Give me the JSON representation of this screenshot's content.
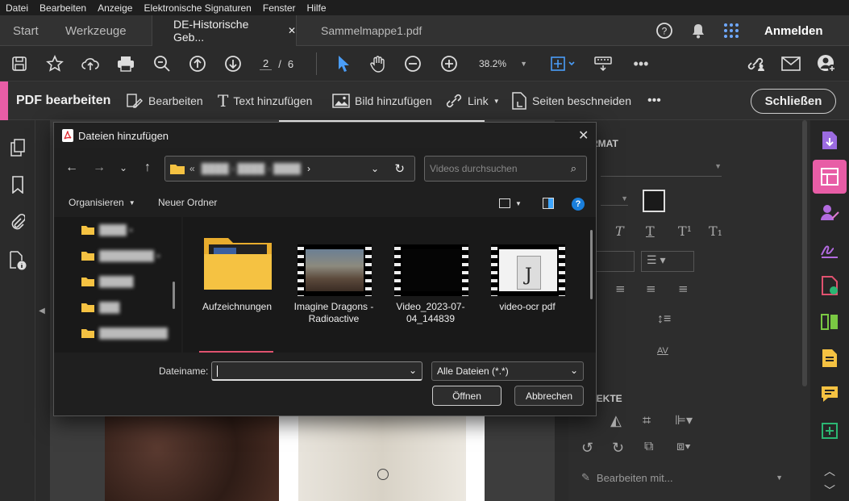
{
  "menu": [
    "Datei",
    "Bearbeiten",
    "Anzeige",
    "Elektronische Signaturen",
    "Fenster",
    "Hilfe"
  ],
  "tabs": {
    "start": "Start",
    "tools": "Werkzeuge",
    "doc1": "DE-Historische Geb...",
    "doc2": "Sammelmappe1.pdf",
    "close": "✕"
  },
  "header": {
    "signin": "Anmelden"
  },
  "toolbar": {
    "page_current": "2",
    "page_sep": "/",
    "page_total": "6",
    "zoom": "38.2%"
  },
  "editbar": {
    "title": "PDF bearbeiten",
    "edit": "Bearbeiten",
    "add_text": "Text hinzufügen",
    "add_image": "Bild hinzufügen",
    "link": "Link",
    "crop": "Seiten beschneiden",
    "more": "•••",
    "close": "Schließen"
  },
  "rightpanel": {
    "format_heading": "RMAT",
    "objects_heading": "JEKTE",
    "edit_with": "Bearbeiten mit..."
  },
  "dialog": {
    "title": "Dateien hinzufügen",
    "search_placeholder": "Videos durchsuchen",
    "organize": "Organisieren",
    "new_folder": "Neuer Ordner",
    "filename_label": "Dateiname:",
    "filename_value": "",
    "filetype": "Alle Dateien (*.*)",
    "open": "Öffnen",
    "cancel": "Abbrechen",
    "items": [
      {
        "label": "Aufzeichnungen",
        "type": "folder"
      },
      {
        "label": "Imagine Dragons - Radioactive",
        "type": "video"
      },
      {
        "label": "Video_2023-07-04_144839",
        "type": "video"
      },
      {
        "label": "video-ocr pdf",
        "type": "video"
      }
    ]
  },
  "colors": {
    "accent": "#e85da6",
    "dialog_bg": "#1f1f1f",
    "folder": "#f5c242",
    "link_blue": "#3ea6ff"
  }
}
